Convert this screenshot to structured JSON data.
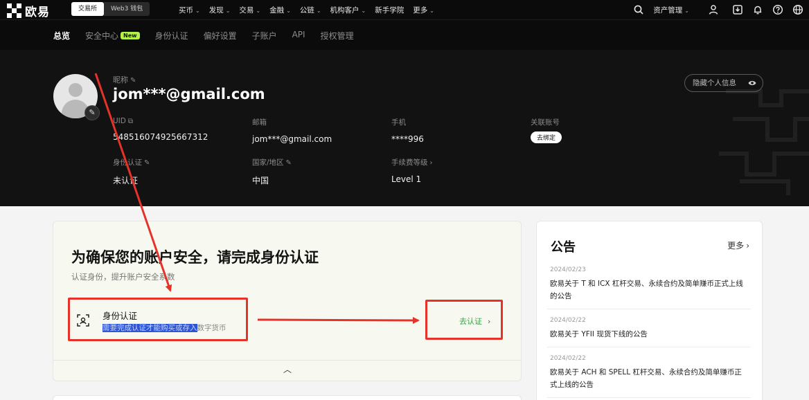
{
  "topnav": {
    "logo_text": "欧易",
    "mode_exchange": "交易所",
    "mode_web3": "Web3 钱包",
    "menu": [
      {
        "label": "买币",
        "has_dropdown": true
      },
      {
        "label": "发现",
        "has_dropdown": true
      },
      {
        "label": "交易",
        "has_dropdown": true
      },
      {
        "label": "金融",
        "has_dropdown": true
      },
      {
        "label": "公链",
        "has_dropdown": true
      },
      {
        "label": "机构客户",
        "has_dropdown": true
      },
      {
        "label": "新手学院",
        "has_dropdown": false
      },
      {
        "label": "更多",
        "has_dropdown": true
      }
    ],
    "asset_menu": "资产管理",
    "icons": [
      "search-icon",
      "user-icon",
      "download-icon",
      "bell-icon",
      "help-icon",
      "globe-icon"
    ]
  },
  "subnav": {
    "items": [
      {
        "label": "总览",
        "active": true
      },
      {
        "label": "安全中心",
        "badge": "New"
      },
      {
        "label": "身份认证"
      },
      {
        "label": "偏好设置"
      },
      {
        "label": "子账户"
      },
      {
        "label": "API"
      },
      {
        "label": "授权管理"
      }
    ]
  },
  "profile": {
    "nickname_label": "昵称",
    "nickname": "jom***@gmail.com",
    "hide_info": "隐藏个人信息",
    "fields": {
      "uid": {
        "label": "UID",
        "value": "548516074925667312"
      },
      "email": {
        "label": "邮箱",
        "value": "jom***@gmail.com"
      },
      "phone": {
        "label": "手机",
        "value": "****996"
      },
      "linked": {
        "label": "关联账号",
        "action": "去绑定"
      },
      "kyc": {
        "label": "身份认证",
        "value": "未认证"
      },
      "country": {
        "label": "国家/地区",
        "value": "中国"
      },
      "fee": {
        "label": "手续费等级",
        "value": "Level 1"
      }
    }
  },
  "verify": {
    "title": "为确保您的账户安全，请完成身份认证",
    "subtitle": "认证身份，提升账户安全系数",
    "item_title": "身份认证",
    "item_desc_selected": "需要完成认证才能购买或存入",
    "item_desc_rest": "数字货币",
    "action": "去认证"
  },
  "notice": {
    "title": "公告",
    "more": "更多",
    "items": [
      {
        "date": "2024/02/23",
        "text": "欧易关于 T 和 ICX 杠杆交易、永续合约及简单赚币正式上线的公告"
      },
      {
        "date": "2024/02/22",
        "text": "欧易关于 YFII 现货下线的公告"
      },
      {
        "date": "2024/02/22",
        "text": "欧易关于 ACH 和 SPELL 杠杆交易、永续合约及简单赚币正式上线的公告"
      }
    ]
  },
  "colors": {
    "nav_bg": "#0b0b0b",
    "profile_bg": "#121212",
    "badge_new": "#b4f24a",
    "verify_action": "#3aa34a",
    "annotation": "#e5332a",
    "selection": "#2b55d6"
  }
}
